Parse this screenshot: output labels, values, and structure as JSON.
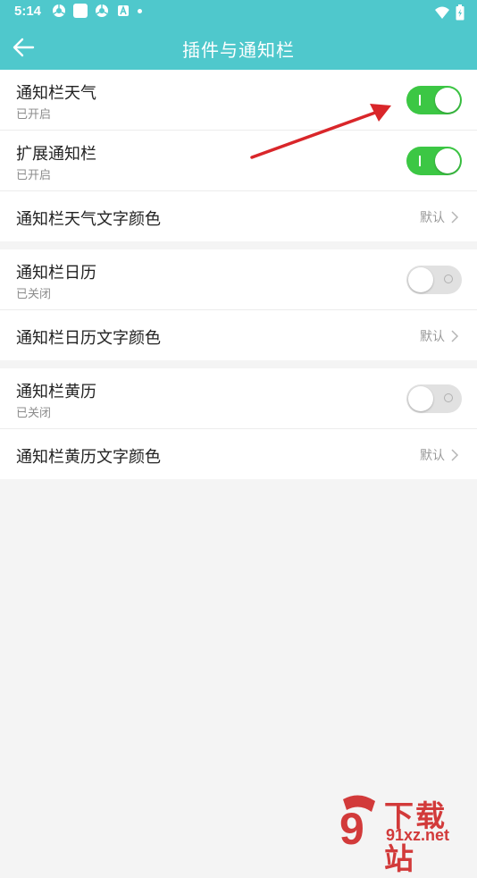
{
  "status_bar": {
    "time": "5:14",
    "icons_left": [
      "chrome-icon",
      "square-app-icon",
      "chrome-icon",
      "a-badge-icon",
      "dot-icon"
    ],
    "icons_right": [
      "wifi-icon",
      "battery-icon"
    ]
  },
  "app_bar": {
    "back_icon": "arrow-left-icon",
    "title": "插件与通知栏"
  },
  "groups": [
    {
      "rows": [
        {
          "title": "通知栏天气",
          "subtitle": "已开启",
          "type": "toggle",
          "on": true
        },
        {
          "title": "扩展通知栏",
          "subtitle": "已开启",
          "type": "toggle",
          "on": true
        },
        {
          "title": "通知栏天气文字颜色",
          "type": "link",
          "value": "默认"
        }
      ]
    },
    {
      "rows": [
        {
          "title": "通知栏日历",
          "subtitle": "已关闭",
          "type": "toggle",
          "on": false
        },
        {
          "title": "通知栏日历文字颜色",
          "type": "link",
          "value": "默认"
        }
      ]
    },
    {
      "rows": [
        {
          "title": "通知栏黄历",
          "subtitle": "已关闭",
          "type": "toggle",
          "on": false
        },
        {
          "title": "通知栏黄历文字颜色",
          "type": "link",
          "value": "默认"
        }
      ]
    }
  ],
  "annotation": {
    "arrow_color": "#d9262a"
  },
  "watermark": {
    "logo_text": "9",
    "line1": "下载站",
    "line2": "91xz.net"
  },
  "colors": {
    "header": "#4fc8cc",
    "toggle_on": "#3cc744",
    "toggle_off": "#e1e1e1"
  }
}
